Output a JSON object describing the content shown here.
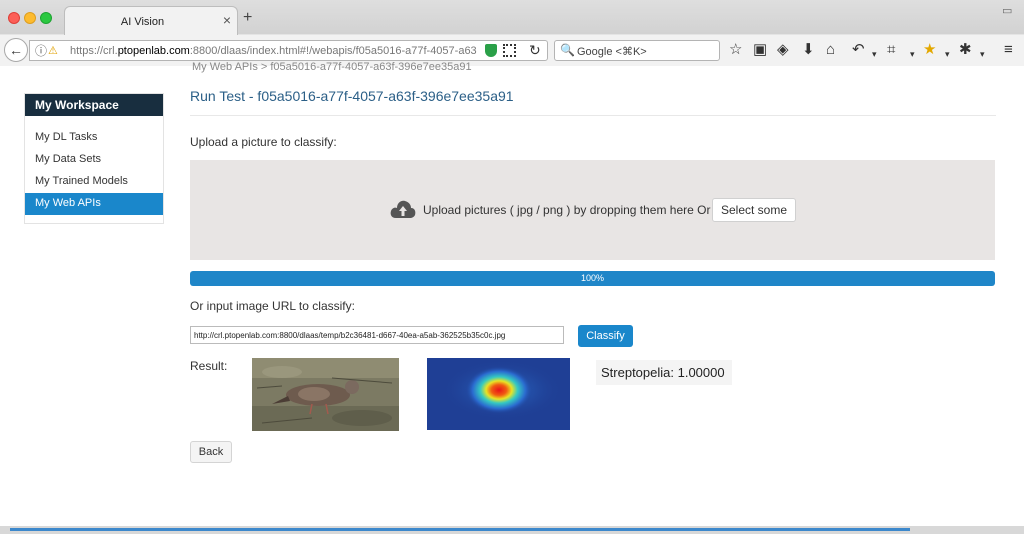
{
  "browser": {
    "tab_title": "AI Vision",
    "tab_close": "×",
    "new_tab": "+",
    "url_prefix": "https://crl.",
    "url_domain": "ptopenlab.com",
    "url_rest": ":8800/dlaas/index.html#!/webapis/f05a5016-a77f-4057-a63",
    "search_placeholder": "Google <⌘K>",
    "icons": [
      "back-arrow-icon",
      "info-icon",
      "warning-lock-icon",
      "shield-icon",
      "qr-icon",
      "reload-icon",
      "search-icon",
      "star-icon",
      "reading-list-icon",
      "pocket-icon",
      "download-icon",
      "home-icon",
      "undo-icon",
      "crop-icon",
      "star-extension-icon",
      "extension-icon",
      "menu-icon"
    ]
  },
  "page": {
    "scrolled_breadcrumb": "My Web APIs  >  f05a5016-a77f-4057-a63f-396e7ee35a91",
    "title": "Run Test - f05a5016-a77f-4057-a63f-396e7ee35a91",
    "upload_label": "Upload a picture to classify:",
    "drop_text": "Upload pictures ( jpg / png ) by dropping them here Or",
    "select_button": "Select some",
    "progress_label": "100%",
    "progress_value": 1.0,
    "url_label": "Or input image URL to classify:",
    "image_url": "http://crl.ptopenlab.com:8800/dlaas/temp/b2c36481-d667-40ea-a5ab-362525b35c0c.jpg",
    "classify_button": "Classify",
    "result_label": "Result:",
    "prediction": "Streptopelia: 1.00000",
    "back_button": "Back"
  },
  "sidebar": {
    "header": "My Workspace",
    "items": [
      {
        "label": "My DL Tasks",
        "active": false
      },
      {
        "label": "My Data Sets",
        "active": false
      },
      {
        "label": "My Trained Models",
        "active": false
      },
      {
        "label": "My Web APIs",
        "active": true
      }
    ]
  },
  "colors": {
    "accent": "#1a87cb",
    "sidebar_header": "#182e3f",
    "title": "#2b5f87"
  }
}
